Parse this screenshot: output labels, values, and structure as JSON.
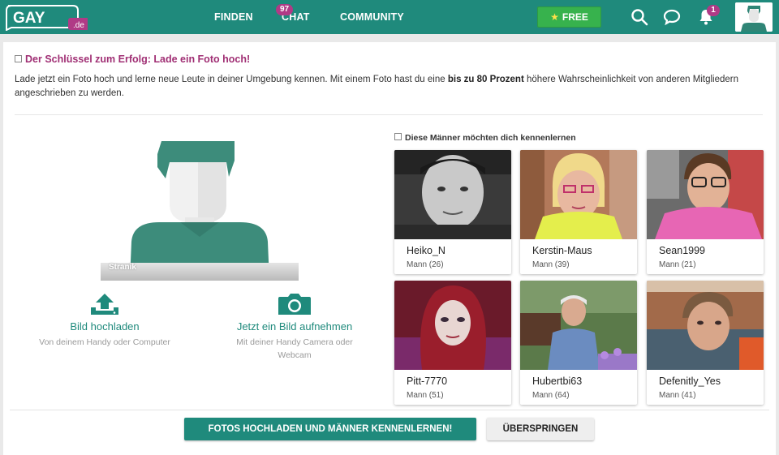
{
  "header": {
    "logo_text": "GAY",
    "logo_suffix": ".de",
    "nav": {
      "finden": "FINDEN",
      "chat": "CHAT",
      "chat_badge": "97",
      "community": "COMMUNITY"
    },
    "free_label": "FREE",
    "notification_count": "1",
    "icons": [
      "search-icon",
      "chat-bubble-icon",
      "bell-icon"
    ]
  },
  "main": {
    "title": "Der Schlüssel zum Erfolg: Lade ein Foto hoch!",
    "intro_before": "Lade jetzt ein Foto hoch und lerne neue Leute in deiner Umgebung kennen. Mit einem Foto hast du eine ",
    "intro_bold": "bis zu 80 Prozent",
    "intro_after": " höhere Wahrscheinlichkeit von anderen Mitgliedern angeschrieben zu werden.",
    "avatar_name": "Stranik",
    "upload": {
      "title": "Bild hochladen",
      "subtitle": "Von deinem Handy oder Computer"
    },
    "camera": {
      "title": "Jetzt ein Bild aufnehmen",
      "subtitle_line1": "Mit deiner Handy Camera oder",
      "subtitle_line2": "Webcam"
    },
    "suggestions_title": "Diese Männer möchten dich kennenlernen",
    "people": [
      {
        "name": "Heiko_N",
        "info": "Mann (26)"
      },
      {
        "name": "Kerstin-Maus",
        "info": "Mann (39)"
      },
      {
        "name": "Sean1999",
        "info": "Mann (21)"
      },
      {
        "name": "Pitt-7770",
        "info": "Mann (51)"
      },
      {
        "name": "Hubertbi63",
        "info": "Mann (64)"
      },
      {
        "name": "Defenitly_Yes",
        "info": "Mann (41)"
      }
    ],
    "primary_button": "FOTOS HOCHLADEN UND MÄNNER KENNENLERNEN!",
    "secondary_button": "ÜBERSPRINGEN"
  },
  "colors": {
    "brand": "#1f8a7c",
    "accent": "#a02f74",
    "free": "#37b24d",
    "badge": "#b03a86"
  }
}
